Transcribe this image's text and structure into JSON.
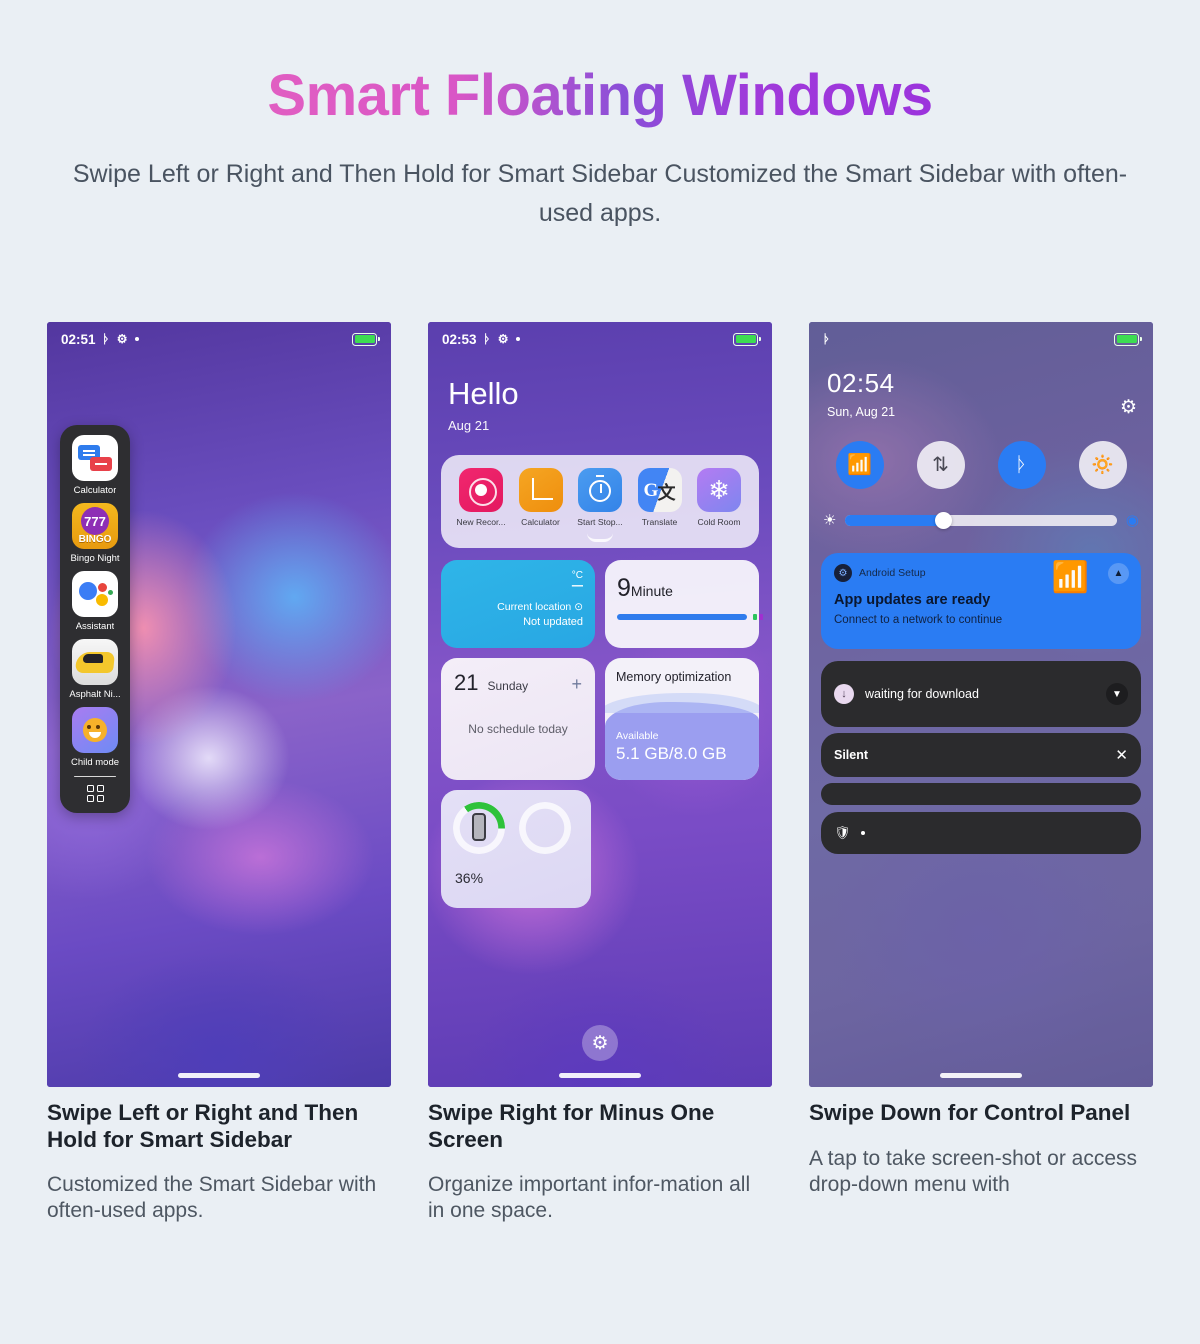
{
  "hero": {
    "title": "Smart Floating Windows",
    "subtitle": "Swipe Left or Right and Then Hold for Smart Sidebar Customized the Smart Sidebar with often-used apps.",
    "gradient_from": "#e35fc3",
    "gradient_to": "#9a33dd"
  },
  "phone1": {
    "status": {
      "time": "02:51",
      "bluetooth_icon": "bluetooth-icon",
      "gear_icon": "gear-icon",
      "dot_icon": "dot-icon",
      "battery_icon": "battery-icon"
    },
    "sidebar": {
      "apps": [
        {
          "label": "Calculator",
          "icon": "calculator-icon"
        },
        {
          "label": "Bingo Night",
          "icon": "bingo-icon",
          "badge": "777",
          "word": "BINGO"
        },
        {
          "label": "Assistant",
          "icon": "google-assistant-icon"
        },
        {
          "label": "Asphalt Ni...",
          "icon": "asphalt-car-icon"
        },
        {
          "label": "Child mode",
          "icon": "child-face-icon"
        }
      ],
      "grid_button": "app-grid-icon"
    }
  },
  "phone2": {
    "status": {
      "time": "02:53",
      "bluetooth_icon": "bluetooth-icon",
      "gear_icon": "gear-icon",
      "dot_icon": "dot-icon",
      "battery_icon": "battery-icon"
    },
    "greeting": "Hello",
    "date": "Aug 21",
    "shortcuts": [
      {
        "label": "New Recor...",
        "icon": "record-icon",
        "color": "#ea1c63"
      },
      {
        "label": "Calculator",
        "icon": "calculator-chart-icon",
        "color": "#f0960f"
      },
      {
        "label": "Start Stop...",
        "icon": "stopwatch-icon",
        "color": "#3b8ceb"
      },
      {
        "label": "Translate",
        "icon": "google-translate-icon",
        "color": "#4285f4"
      },
      {
        "label": "Cold Room",
        "icon": "snowflake-icon",
        "color": "#9a7ff0"
      }
    ],
    "collapse_icon": "chevron-down-icon",
    "weather": {
      "unit": "°C",
      "temp": "–",
      "location": "Current location",
      "location_pin": "⊙",
      "status": "Not updated"
    },
    "timer": {
      "value": "9",
      "unit": "Minute"
    },
    "calendar": {
      "day_number": "21",
      "day_name": "Sunday",
      "add_icon": "plus-icon",
      "empty_text": "No schedule today"
    },
    "memory": {
      "title": "Memory optimization",
      "available_label": "Available",
      "value": "5.1 GB/8.0 GB"
    },
    "battery_widget": {
      "percent": "36%",
      "phone_icon": "phone-battery-icon"
    },
    "settings_button": "gear-icon"
  },
  "phone3": {
    "status": {
      "bluetooth_icon": "bluetooth-icon",
      "battery_icon": "battery-icon"
    },
    "time": "02:54",
    "date": "Sun, Aug 21",
    "settings_icon": "gear-icon",
    "toggles": [
      {
        "name": "wifi-toggle",
        "icon": "●",
        "state": "on"
      },
      {
        "name": "mobile-data-toggle",
        "icon": "⇅",
        "state": "off"
      },
      {
        "name": "bluetooth-toggle",
        "icon": "ᛦ",
        "state": "on"
      },
      {
        "name": "flashlight-toggle",
        "icon": "▌",
        "state": "off"
      }
    ],
    "brightness": {
      "icon": "brightness-icon",
      "value_percent": 36,
      "auto_icon": "auto-brightness-icon"
    },
    "notifications": [
      {
        "app": "Android Setup",
        "title": "App updates are ready",
        "subtitle": "Connect to a network to continue",
        "icon": "android-setup-icon",
        "art_icon": "wifi-off-icon",
        "expand_icon": "chevron-up-icon",
        "style": "blue"
      },
      {
        "title": "waiting for download",
        "icon": "download-icon",
        "expand_icon": "chevron-down-icon",
        "style": "dark"
      },
      {
        "title": "Silent",
        "close_icon": "close-icon",
        "style": "dark"
      },
      {
        "title": "",
        "style": "dark-thin"
      },
      {
        "title": "",
        "icon": "shield-icon",
        "dot": "•",
        "style": "dark-shield"
      }
    ]
  },
  "captions": [
    {
      "heading": "Swipe Left or Right and Then Hold for Smart Sidebar",
      "body": "Customized the Smart Sidebar with often-used apps."
    },
    {
      "heading": "Swipe Right for Minus One Screen",
      "body": "Organize important infor-mation all in one space."
    },
    {
      "heading": "Swipe Down for Control Panel",
      "body": "A tap to take screen-shot or access drop-down menu with"
    }
  ]
}
